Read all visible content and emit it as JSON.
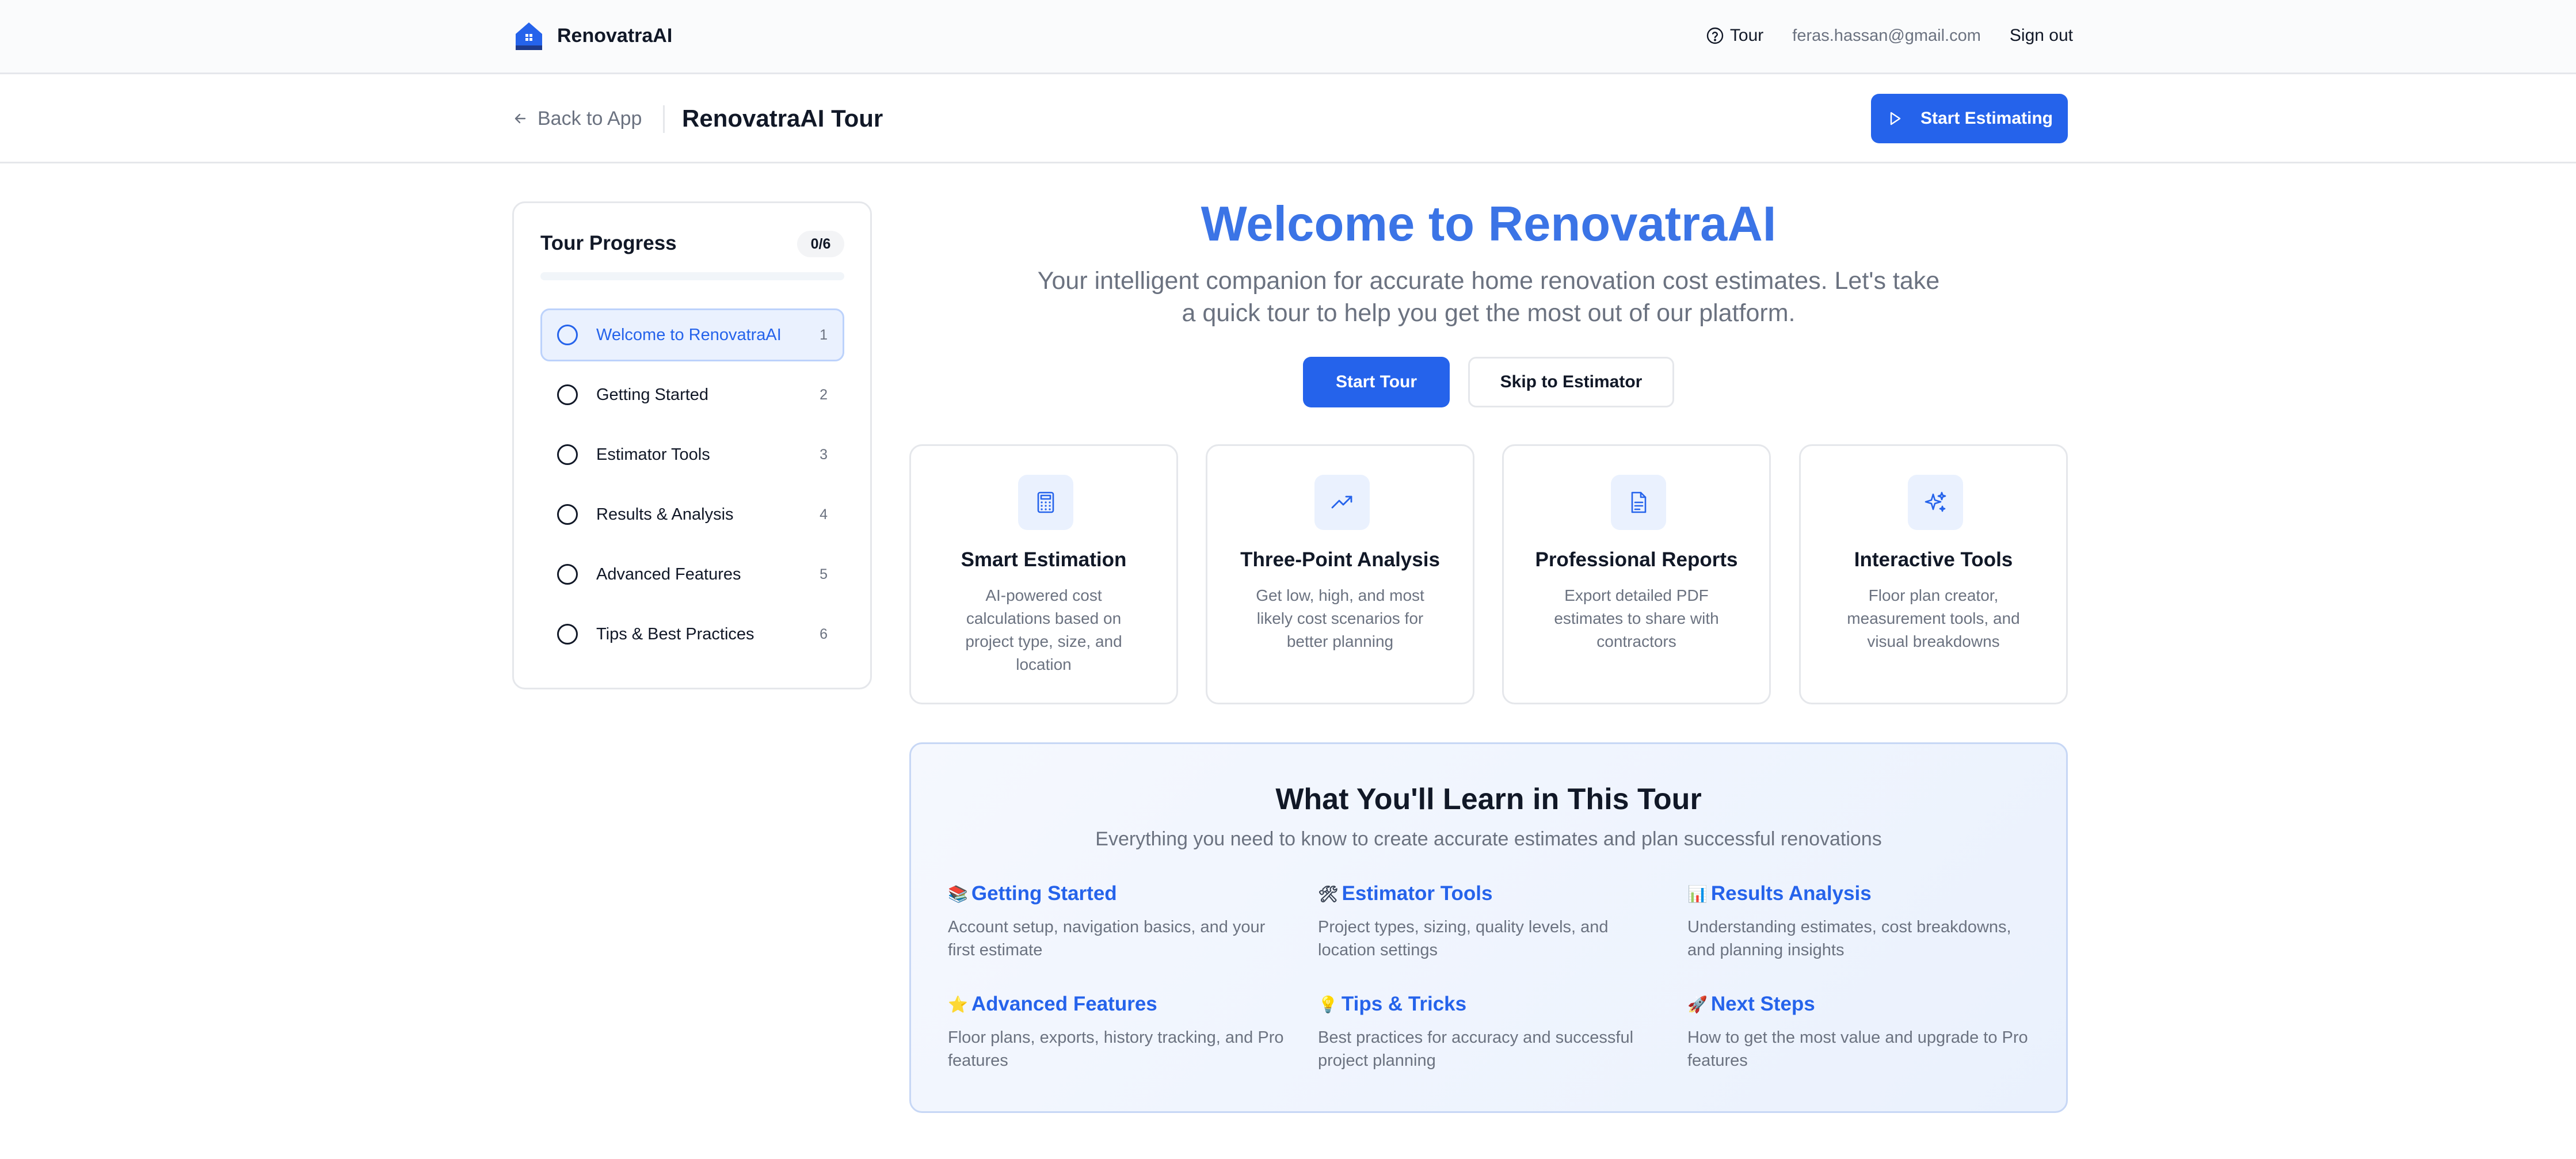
{
  "app": {
    "brand_name": "RenovatraAI",
    "nav_tour": "Tour",
    "user_email": "feras.hassan@gmail.com",
    "sign_out": "Sign out"
  },
  "subheader": {
    "back_label": "Back to App",
    "title": "RenovatraAI Tour",
    "start_estimating": "Start Estimating"
  },
  "sidebar": {
    "title": "Tour Progress",
    "count": "0/6",
    "progress_fraction": 0,
    "items": [
      {
        "label": "Welcome to RenovatraAI",
        "num": "1",
        "active": true
      },
      {
        "label": "Getting Started",
        "num": "2",
        "active": false
      },
      {
        "label": "Estimator Tools",
        "num": "3",
        "active": false
      },
      {
        "label": "Results & Analysis",
        "num": "4",
        "active": false
      },
      {
        "label": "Advanced Features",
        "num": "5",
        "active": false
      },
      {
        "label": "Tips & Best Practices",
        "num": "6",
        "active": false
      }
    ]
  },
  "hero": {
    "title": "Welcome to RenovatraAI",
    "subtitle": "Your intelligent companion for accurate home renovation cost estimates. Let's take a quick tour to help you get the most out of our platform.",
    "start_tour": "Start Tour",
    "skip": "Skip to Estimator"
  },
  "features": [
    {
      "icon": "calculator-icon",
      "title": "Smart Estimation",
      "desc": "AI-powered cost calculations based on project type, size, and location"
    },
    {
      "icon": "trending-up-icon",
      "title": "Three-Point Analysis",
      "desc": "Get low, high, and most likely cost scenarios for better planning"
    },
    {
      "icon": "document-icon",
      "title": "Professional Reports",
      "desc": "Export detailed PDF estimates to share with contractors"
    },
    {
      "icon": "sparkles-icon",
      "title": "Interactive Tools",
      "desc": "Floor plan creator, measurement tools, and visual breakdowns"
    }
  ],
  "learn": {
    "title": "What You'll Learn in This Tour",
    "subtitle": "Everything you need to know to create accurate estimates and plan successful renovations",
    "items": [
      {
        "emoji": "📚",
        "title": "Getting Started",
        "desc": "Account setup, navigation basics, and your first estimate"
      },
      {
        "emoji": "🛠",
        "title": "Estimator Tools",
        "desc": "Project types, sizing, quality levels, and location settings"
      },
      {
        "emoji": "📊",
        "title": "Results Analysis",
        "desc": "Understanding estimates, cost breakdowns, and planning insights"
      },
      {
        "emoji": "⭐",
        "title": "Advanced Features",
        "desc": "Floor plans, exports, history tracking, and Pro features"
      },
      {
        "emoji": "💡",
        "title": "Tips & Tricks",
        "desc": "Best practices for accuracy and successful project planning"
      },
      {
        "emoji": "🚀",
        "title": "Next Steps",
        "desc": "How to get the most value and upgrade to Pro features"
      }
    ]
  },
  "colors": {
    "primary": "#2563eb",
    "hero_title": "#3b74e6",
    "muted_text": "#6b7280",
    "border": "#e5e7eb"
  }
}
